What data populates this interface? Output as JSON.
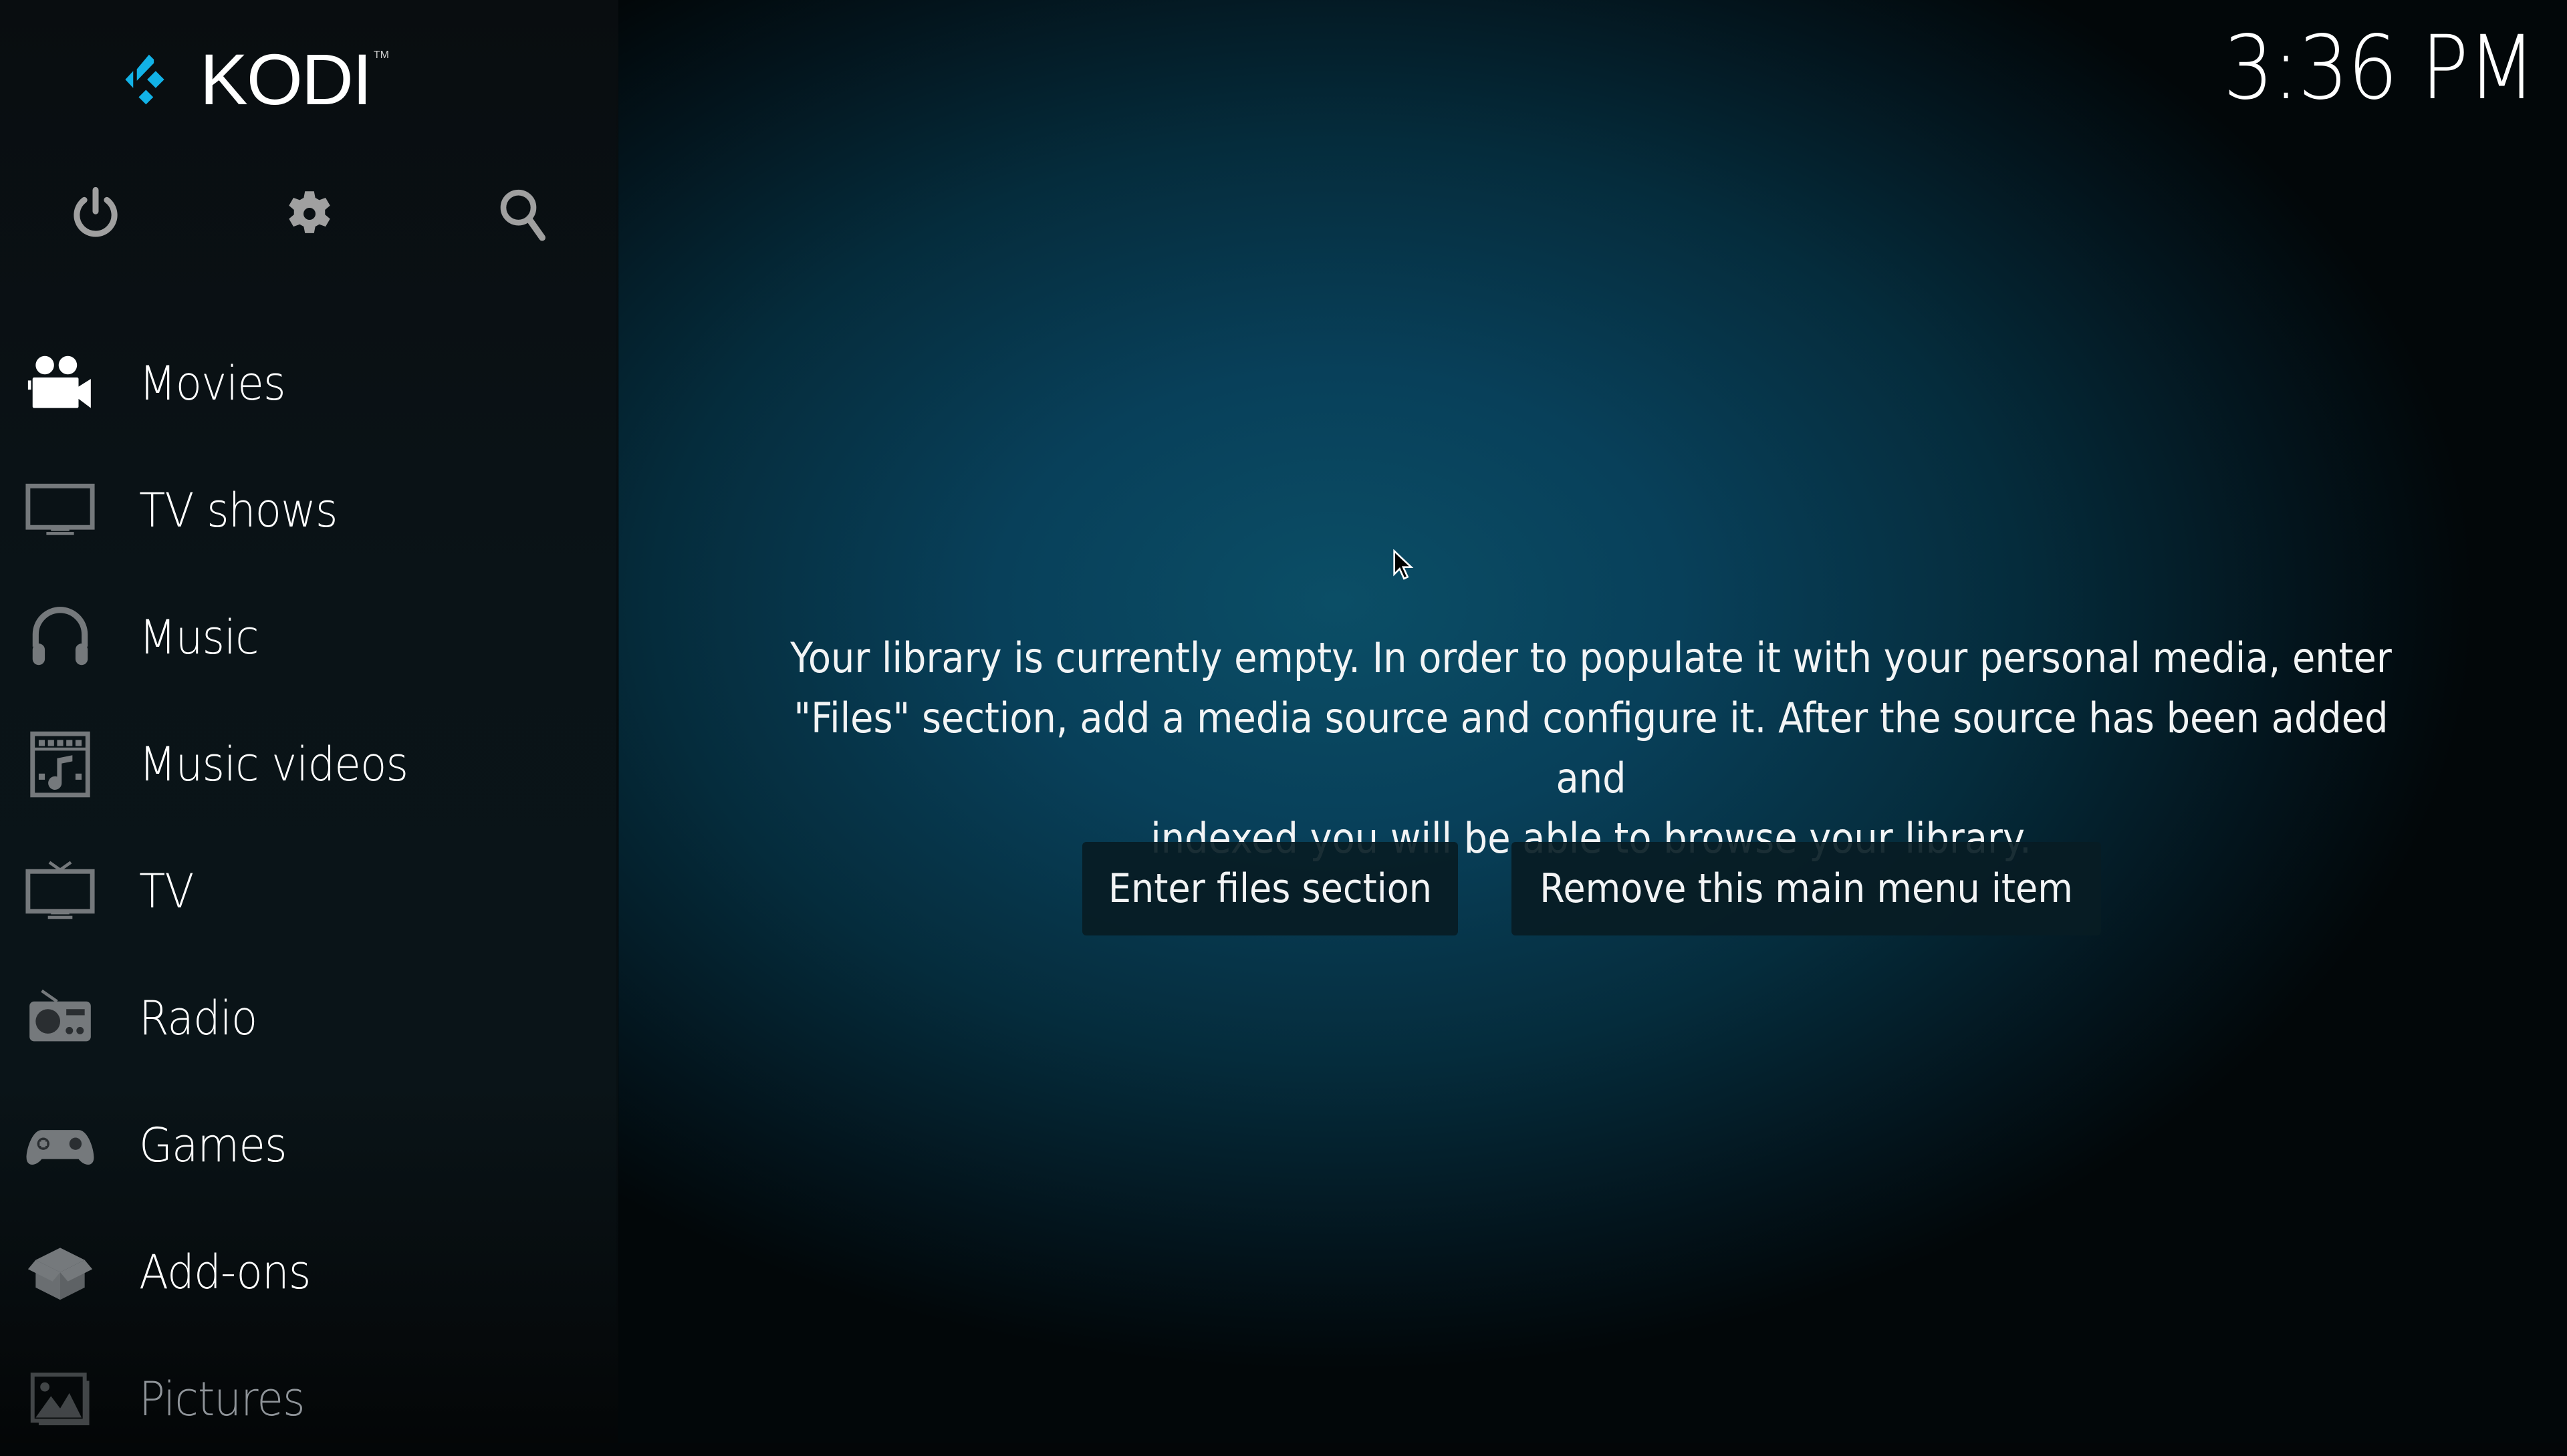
{
  "app": {
    "name": "KODI",
    "trademark": "TM",
    "brand_color": "#12b2e7"
  },
  "header": {
    "clock": "3:36 PM"
  },
  "top_buttons": [
    {
      "name": "power",
      "icon": "power-icon"
    },
    {
      "name": "settings",
      "icon": "gear-icon"
    },
    {
      "name": "search",
      "icon": "search-icon"
    }
  ],
  "sidebar": {
    "items": [
      {
        "label": "Movies",
        "icon": "movie-camera-icon",
        "focused": true
      },
      {
        "label": "TV shows",
        "icon": "monitor-icon"
      },
      {
        "label": "Music",
        "icon": "headphones-icon"
      },
      {
        "label": "Music videos",
        "icon": "music-video-icon"
      },
      {
        "label": "TV",
        "icon": "tv-antenna-icon"
      },
      {
        "label": "Radio",
        "icon": "radio-icon"
      },
      {
        "label": "Games",
        "icon": "gamepad-icon"
      },
      {
        "label": "Add-ons",
        "icon": "addon-box-icon"
      },
      {
        "label": "Pictures",
        "icon": "picture-icon",
        "dimmed": true
      }
    ]
  },
  "main": {
    "message_lines": [
      "Your library is currently empty. In order to populate it with your personal media, enter",
      "\"Files\" section, add a media source and configure it. After the source has been added and",
      "indexed you will be able to browse your library."
    ],
    "buttons": {
      "enter_files": "Enter files section",
      "remove_item": "Remove this main menu item"
    }
  },
  "colors": {
    "icon_focused": "#ffffff",
    "icon_default": "#75797c",
    "text": "#ffffff"
  }
}
